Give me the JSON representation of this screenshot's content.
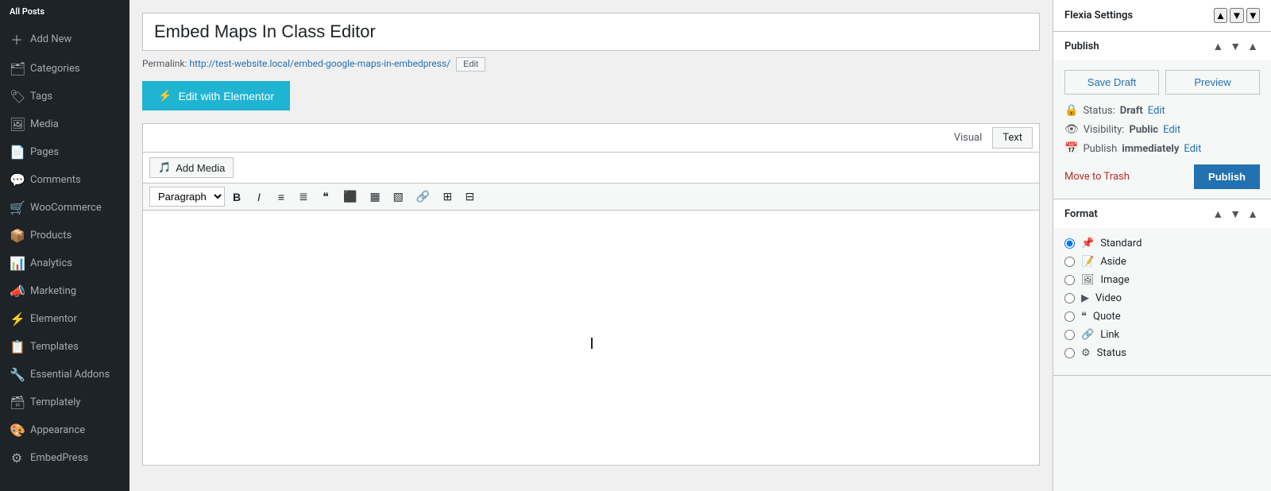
{
  "sidebar": {
    "header": "All Posts",
    "items": [
      {
        "id": "add-new",
        "label": "Add New",
        "icon": "＋"
      },
      {
        "id": "categories",
        "label": "Categories",
        "icon": "🗂"
      },
      {
        "id": "tags",
        "label": "Tags",
        "icon": "🏷"
      },
      {
        "id": "media",
        "label": "Media",
        "icon": "🖼"
      },
      {
        "id": "pages",
        "label": "Pages",
        "icon": "📄"
      },
      {
        "id": "comments",
        "label": "Comments",
        "icon": "💬"
      },
      {
        "id": "woocommerce",
        "label": "WooCommerce",
        "icon": "🛒"
      },
      {
        "id": "products",
        "label": "Products",
        "icon": "📦"
      },
      {
        "id": "analytics",
        "label": "Analytics",
        "icon": "📊"
      },
      {
        "id": "marketing",
        "label": "Marketing",
        "icon": "📣"
      },
      {
        "id": "elementor",
        "label": "Elementor",
        "icon": "⚡"
      },
      {
        "id": "templates",
        "label": "Templates",
        "icon": "📋"
      },
      {
        "id": "essential-addons",
        "label": "Essential Addons",
        "icon": "🔧"
      },
      {
        "id": "templately",
        "label": "Templately",
        "icon": "🗃"
      },
      {
        "id": "appearance",
        "label": "Appearance",
        "icon": "🎨"
      },
      {
        "id": "embedpress",
        "label": "EmbedPress",
        "icon": "⚙"
      }
    ]
  },
  "editor": {
    "title": "Embed Maps In Class Editor",
    "permalink_label": "Permalink:",
    "permalink_url": "http://test-website.local/embed-google-maps-in-embedpress/",
    "permalink_edit_btn": "Edit",
    "elementor_btn": "Edit with Elementor",
    "add_media_btn": "Add Media",
    "tab_visual": "Visual",
    "tab_text": "Text",
    "paragraph_select": "Paragraph",
    "toolbar_buttons": [
      "B",
      "I",
      "≡",
      "≡",
      "❝",
      "≡",
      "≡",
      "≡",
      "🔗",
      "⊞",
      "⊟"
    ]
  },
  "right_panel": {
    "flexia_settings_label": "Flexia Settings",
    "publish_section": {
      "title": "Publish",
      "save_draft_label": "Save Draft",
      "preview_label": "Preview",
      "status_label": "Status:",
      "status_value": "Draft",
      "status_edit": "Edit",
      "visibility_label": "Visibility:",
      "visibility_value": "Public",
      "visibility_edit": "Edit",
      "publish_label": "Publish",
      "publish_when": "immediately",
      "publish_edit": "Edit",
      "move_trash": "Move to Trash",
      "publish_btn": "Publish"
    },
    "format_section": {
      "title": "Format",
      "options": [
        {
          "id": "standard",
          "label": "Standard",
          "icon": "📌",
          "checked": true
        },
        {
          "id": "aside",
          "label": "Aside",
          "icon": "📝",
          "checked": false
        },
        {
          "id": "image",
          "label": "Image",
          "icon": "🖼",
          "checked": false
        },
        {
          "id": "video",
          "label": "Video",
          "icon": "▶",
          "checked": false
        },
        {
          "id": "quote",
          "label": "Quote",
          "icon": "❝",
          "checked": false
        },
        {
          "id": "link",
          "label": "Link",
          "icon": "🔗",
          "checked": false
        },
        {
          "id": "status",
          "label": "Status",
          "icon": "⚙",
          "checked": false
        }
      ]
    }
  }
}
